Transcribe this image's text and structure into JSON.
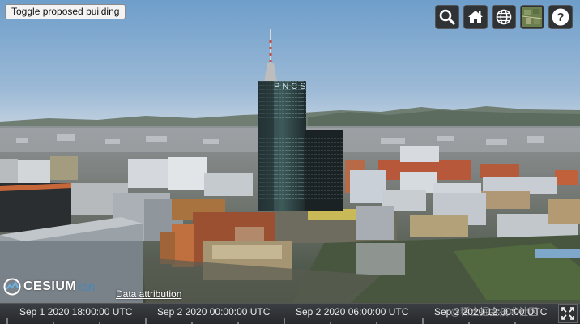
{
  "toggle_button": {
    "label": "Toggle proposed building"
  },
  "toolbar": {
    "buttons": [
      {
        "name": "geocoder",
        "icon": "search-icon"
      },
      {
        "name": "home",
        "icon": "home-icon"
      },
      {
        "name": "scene-mode",
        "icon": "globe-icon"
      },
      {
        "name": "base-layer-picker",
        "icon": "imagery-thumbnail-icon"
      },
      {
        "name": "navigation-help",
        "icon": "help-icon"
      }
    ]
  },
  "sign": {
    "text": "PNCS"
  },
  "credits": {
    "logo_text": "CESIUM",
    "logo_suffix": "ion",
    "attribution_link": "Data attribution"
  },
  "timeline": {
    "labels": [
      "Sep 1 2020 18:00:00 UTC",
      "Sep 2 2020 00:00:00 UTC",
      "Sep 2 2020 06:00:00 UTC",
      "Sep 2 2020 12:00:00 UTC"
    ]
  },
  "watermark": "@稀土掘金技术社区",
  "colors": {
    "sky_top": "#6e9ecb",
    "sky_horizon": "#b8cde0",
    "toolbar_bg": "#303336",
    "timeline_bg": "#2e3134"
  }
}
